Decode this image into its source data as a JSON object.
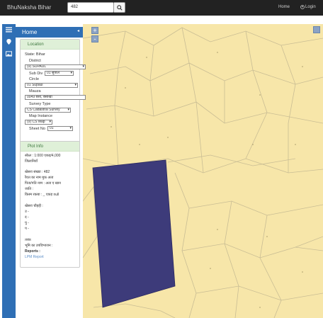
{
  "header": {
    "brand": "BhuNaksha Bihar",
    "search_value": "482",
    "home_label": "Home",
    "login_label": "Login"
  },
  "panel": {
    "title": "Home",
    "location": {
      "heading": "Location",
      "state": "State: Bihar",
      "district_label": "District",
      "district_value": "(9) SUPAUL",
      "subdiv_label": "Sub Div",
      "subdiv_value": "01 सुपौल",
      "circle_label": "Circle",
      "circle_value": "01 Supaul",
      "mauza_label": "Mauza",
      "mauza_value": "0049 बैसी, बैसाखी",
      "survey_label": "Survey Type",
      "survey_value": "CS Cadastral Survey",
      "map_instance_label": "Map Instance",
      "map_instance_value": "(9) CS Map",
      "sheet_label": "Sheet No",
      "sheet_value": "01"
    },
    "plot_info": {
      "heading": "Plot Info",
      "scale": "स्केल : 1:000 एकड़/4,000",
      "district": "जिलानियाँ",
      "khesra": "खेसरा संख्या : 482",
      "owner_line": "रैयत का नाम मुफ़ अता",
      "father_line": "पिता/पति नाम : अता  ए खान",
      "caste": "जाति :",
      "land_type": "किस्म रकबा : _ एकड़ null",
      "boundary_title": "खेसरा चौहद्दी :",
      "north": "उ -",
      "south": "द -",
      "east": "पु -",
      "west": "प -",
      "area": "तरफ़",
      "land_use": "भूमि का उपविभाजन :",
      "reports_label": "Reports :",
      "report_link": "LPM Report"
    }
  },
  "map": {
    "zoom_in": "+",
    "zoom_out": "-",
    "parcel_fill": "#3d3b7a",
    "background": "#f7e6a9"
  },
  "colors": {
    "navbar": "#222222",
    "accent_blue": "#2f6fb5",
    "panel_header_green": "#dff0d8"
  }
}
